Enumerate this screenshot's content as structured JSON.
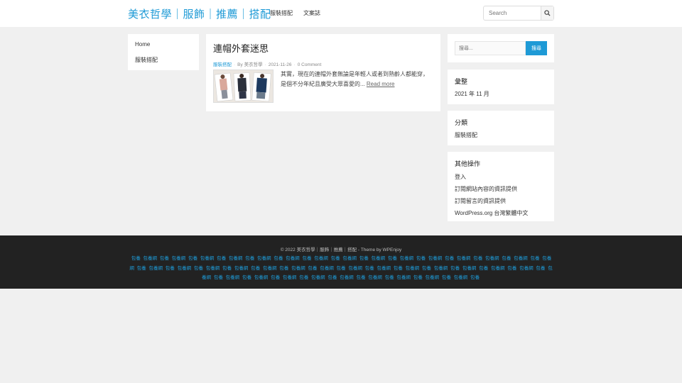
{
  "header": {
    "site_title": "美衣哲學｜服飾｜推薦｜搭配",
    "nav": [
      "服裝搭配",
      "文案誌"
    ],
    "search_placeholder": "Search",
    "search_icon": "search-icon"
  },
  "left_nav": {
    "items": [
      "Home",
      "服裝搭配"
    ]
  },
  "post": {
    "title": "連帽外套迷思",
    "category": "服裝搭配",
    "author": "By 美衣哲學",
    "date": "2021-11-26",
    "comments": "0 Comment",
    "excerpt": "其實，現在的連帽外套無論是年輕人或者到熟齡人都能穿，是個不分年紀且廣受大眾喜愛的...",
    "read_more": "Read more"
  },
  "sidebar": {
    "search": {
      "placeholder": "搜尋...",
      "button": "搜尋"
    },
    "archive": {
      "title": "彙整",
      "items": [
        "2021 年 11 月"
      ]
    },
    "categories": {
      "title": "分類",
      "items": [
        "服裝搭配"
      ]
    },
    "meta": {
      "title": "其他操作",
      "items": [
        "登入",
        "訂閱網站內容的資訊提供",
        "訂閱留言的資訊提供",
        "WordPress.org 台灣繁體中文"
      ]
    }
  },
  "footer": {
    "copyright": "© 2022 美衣哲學｜服飾｜推薦｜搭配 - Theme by WPEnjoy",
    "tags": [
      "包養",
      "包養網",
      "包養",
      "包養網",
      "包養",
      "包養網",
      "包養",
      "包養網",
      "包養",
      "包養網",
      "包養",
      "包養網",
      "包養",
      "包養網",
      "包養",
      "包養網",
      "包養",
      "包養網",
      "包養",
      "包養網",
      "包養",
      "包養網",
      "包養",
      "包養網",
      "包養",
      "包養網",
      "包養",
      "包養網",
      "包養",
      "包養網",
      "包養",
      "包養網",
      "包養",
      "包養網",
      "包養",
      "包養網",
      "包養",
      "包養網",
      "包養",
      "包養網",
      "包養",
      "包養網",
      "包養",
      "包養網",
      "包養",
      "包養網",
      "包養",
      "包養網",
      "包養",
      "包養網",
      "包養",
      "包養網",
      "包養",
      "包養網",
      "包養",
      "包養網",
      "包養",
      "包養網",
      "包養",
      "包養網",
      "包養",
      "包養網",
      "包養",
      "包養網",
      "包養",
      "包養網",
      "包養",
      "包養網",
      "包養",
      "包養網",
      "包養",
      "包養網",
      "包養",
      "包養網",
      "包養",
      "包養網",
      "包養",
      "包養網",
      "包養"
    ]
  },
  "colors": {
    "accent": "#1e9ad6",
    "footer_bg": "#222222",
    "page_bg": "#f0f0f0"
  }
}
